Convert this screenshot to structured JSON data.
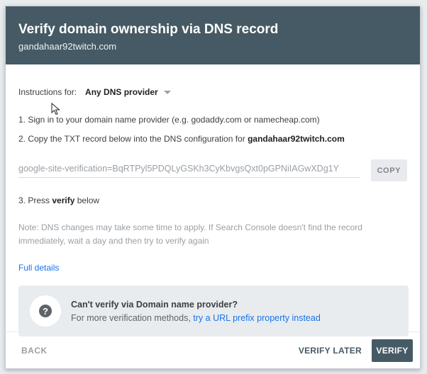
{
  "header": {
    "title": "Verify domain ownership via DNS record",
    "domain": "gandahaar92twitch.com"
  },
  "instructions": {
    "label": "Instructions for:",
    "provider": "Any DNS provider"
  },
  "steps": {
    "step1": "1. Sign in to your domain name provider (e.g. godaddy.com or namecheap.com)",
    "step2_prefix": "2. Copy the TXT record below into the DNS configuration for ",
    "step2_domain": "gandahaar92twitch.com",
    "step3_prefix": "3. Press ",
    "step3_bold": "verify",
    "step3_suffix": " below"
  },
  "record": {
    "value": "google-site-verification=BqRTPyl5PDQLyGSKh3CyKbvgsQxt0pGPNiIAGwXDg1Y",
    "copy_label": "COPY"
  },
  "note": "Note: DNS changes may take some time to apply. If Search Console doesn't find the record immediately, wait a day and then try to verify again",
  "full_details": "Full details",
  "alternative": {
    "title": "Can't verify via Domain name provider?",
    "body_prefix": "For more verification methods, ",
    "link": "try a URL prefix property instead",
    "icon": "help-icon"
  },
  "footer": {
    "back": "BACK",
    "verify_later": "VERIFY LATER",
    "verify": "VERIFY"
  },
  "colors": {
    "header_bg": "#455a64",
    "link": "#1a73e8",
    "primary_button": "#455a64"
  }
}
